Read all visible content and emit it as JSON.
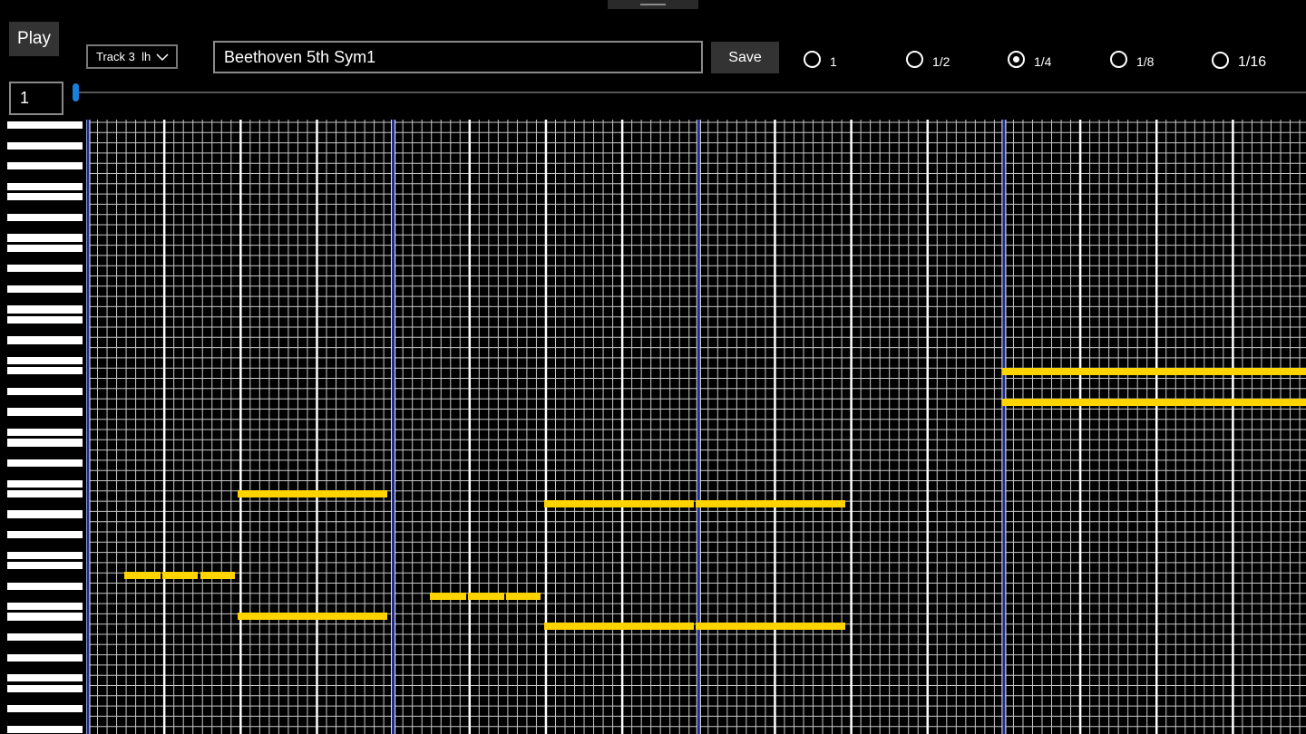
{
  "toolbar": {
    "play_label": "Play",
    "track": "Track 3  lh",
    "title": "Beethoven 5th Sym1",
    "save_label": "Save",
    "measure": "1"
  },
  "note_divisions": [
    {
      "label": "1",
      "checked": false
    },
    {
      "label": "1/2",
      "checked": false
    },
    {
      "label": "1/4",
      "checked": true
    },
    {
      "label": "1/8",
      "checked": false
    },
    {
      "label": "1/16",
      "checked": false
    }
  ],
  "colors": {
    "background": "#000000",
    "grid_line": "#c8c8c8",
    "beat_line": "#ffffff",
    "measure_line": "#1b2a8f",
    "note": "#ffd400"
  },
  "icons": {
    "track_dropdown": "chevron-down-icon"
  }
}
